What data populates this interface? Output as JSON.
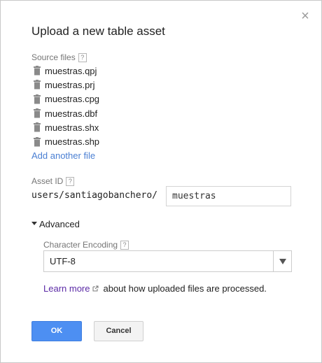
{
  "dialog": {
    "title": "Upload a new table asset",
    "close_label": "×"
  },
  "source_files": {
    "label": "Source files",
    "help": "?",
    "files": [
      "muestras.qpj",
      "muestras.prj",
      "muestras.cpg",
      "muestras.dbf",
      "muestras.shx",
      "muestras.shp"
    ],
    "add_label": "Add another file"
  },
  "asset_id": {
    "label": "Asset ID",
    "help": "?",
    "prefix": "users/santiagobanchero/",
    "value": "muestras"
  },
  "advanced": {
    "label": "Advanced",
    "encoding_label": "Character Encoding",
    "encoding_help": "?",
    "encoding_value": "UTF-8"
  },
  "info": {
    "link_text": "Learn more",
    "suffix": "about how uploaded files are processed."
  },
  "buttons": {
    "ok": "OK",
    "cancel": "Cancel"
  },
  "colors": {
    "primary": "#4d8ff2",
    "link": "#4a7fd3",
    "visited_link": "#5b2aa6"
  },
  "icons": {
    "close": "close-icon",
    "delete": "trash-icon",
    "help": "help-icon",
    "expand": "caret-down-icon",
    "dropdown": "dropdown-arrow-icon",
    "external": "external-link-icon"
  }
}
